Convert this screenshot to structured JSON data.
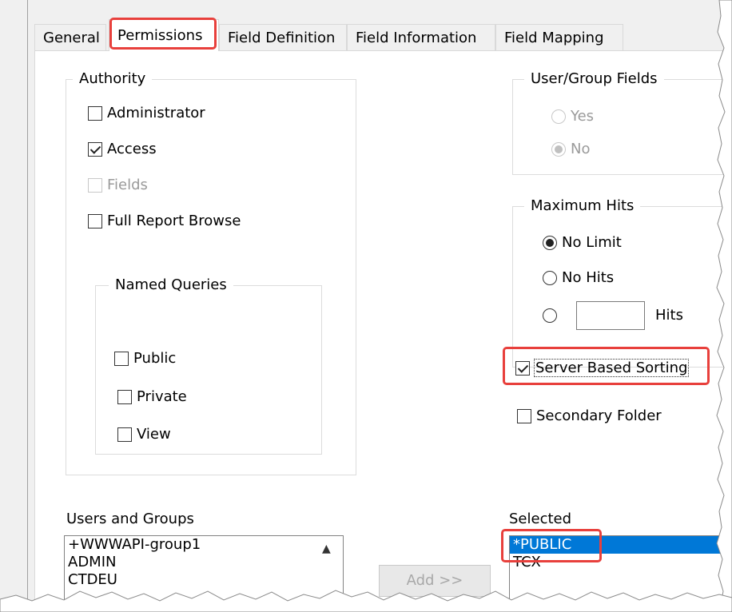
{
  "tabs": [
    "General",
    "Permissions",
    "Field Definition",
    "Field Information",
    "Field Mapping"
  ],
  "authority": {
    "title": "Authority",
    "administrator": "Administrator",
    "access": "Access",
    "fields": "Fields",
    "full_report_browse": "Full Report Browse"
  },
  "named_queries": {
    "title": "Named Queries",
    "public": "Public",
    "private": "Private",
    "view": "View"
  },
  "user_group_fields": {
    "title": "User/Group Fields",
    "yes": "Yes",
    "no": "No",
    "selected": "No"
  },
  "maximum_hits": {
    "title": "Maximum Hits",
    "no_limit": "No Limit",
    "no_hits": "No Hits",
    "hits": "Hits",
    "hits_value": "",
    "selected": "No Limit"
  },
  "secondary_folder": "Secondary Folder",
  "server_based_sorting": "Server Based Sorting",
  "users_and_groups": {
    "label": "Users and Groups",
    "items": [
      "+WWWAPI-group1",
      "ADMIN",
      "CTDEU"
    ]
  },
  "add_button": "Add >>",
  "selected_list": {
    "label": "Selected",
    "items": [
      "*PUBLIC",
      "TCX"
    ]
  },
  "colors": {
    "highlight": "#e8403c",
    "selection": "#0078d7"
  }
}
